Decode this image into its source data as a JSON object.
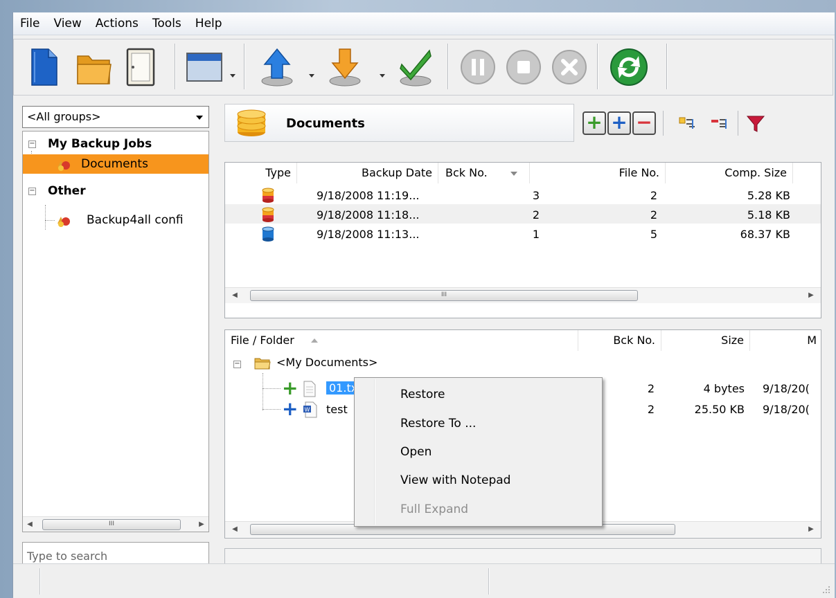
{
  "menu": [
    "File",
    "View",
    "Actions",
    "Tools",
    "Help"
  ],
  "icons": {
    "new": "new-file-icon",
    "open": "open-folder-icon",
    "properties": "properties-icon",
    "layout": "layout-icon",
    "backup": "backup-up-arrow-icon",
    "restore": "restore-down-arrow-icon",
    "test": "test-checkmark-icon",
    "pause": "pause-icon",
    "stop": "stop-icon",
    "cancel": "cancel-icon",
    "refresh": "refresh-icon"
  },
  "left": {
    "group_select": "<All groups>",
    "tree": [
      {
        "label": "My Backup Jobs",
        "bold": true
      },
      {
        "label": "Documents",
        "selected": true
      },
      {
        "label": "Other",
        "bold": true
      },
      {
        "label": "Backup4all confi"
      }
    ],
    "search_placeholder": "Type to search"
  },
  "header": {
    "title": "Documents"
  },
  "backups": {
    "columns": [
      "Type",
      "Backup Date",
      "Bck No.",
      "File No.",
      "Comp. Size"
    ],
    "rows": [
      {
        "type": "incremental",
        "date": "9/18/2008 11:19...",
        "bck": "3",
        "files": "2",
        "size": "5.28 KB"
      },
      {
        "type": "incremental",
        "date": "9/18/2008 11:18...",
        "bck": "2",
        "files": "2",
        "size": "5.18 KB"
      },
      {
        "type": "full",
        "date": "9/18/2008 11:13...",
        "bck": "1",
        "files": "5",
        "size": "68.37 KB"
      }
    ]
  },
  "files": {
    "columns": [
      "File / Folder",
      "Bck No.",
      "Size",
      "M"
    ],
    "root": "<My Documents>",
    "rows": [
      {
        "name": "01.txt",
        "bck": "2",
        "size": "4 bytes",
        "modified": "9/18/20(",
        "selected": true
      },
      {
        "name": "test",
        "bck": "2",
        "size": "25.50 KB",
        "modified": "9/18/20("
      }
    ]
  },
  "context_menu": {
    "items": [
      {
        "label": "Restore",
        "enabled": true
      },
      {
        "label": "Restore To ...",
        "enabled": true
      },
      {
        "label": "Open",
        "enabled": true
      },
      {
        "label": "View with Notepad",
        "enabled": true
      },
      {
        "label": "Full Expand",
        "enabled": false
      }
    ]
  },
  "scroll_glyph": "III",
  "colors": {
    "selection": "#f7951d",
    "file_selection": "#3399ff",
    "add_green": "#3a9b2a",
    "add_blue": "#1d5fc4",
    "remove_red": "#d8343c"
  }
}
